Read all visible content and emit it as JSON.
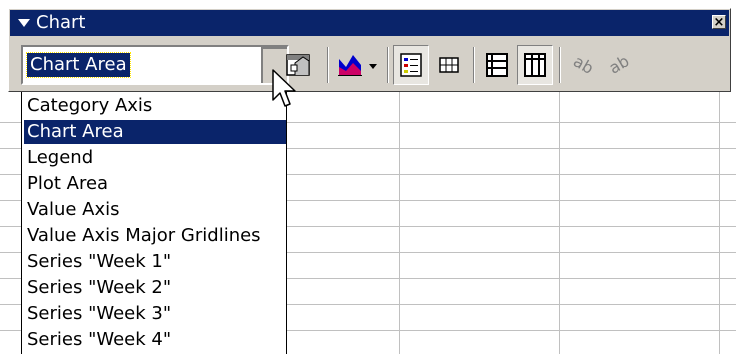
{
  "toolbar": {
    "title": "Chart",
    "close_symbol": "×",
    "chart_objects": {
      "selected": "Chart Area",
      "options": [
        "Category Axis",
        "Chart Area",
        "Legend",
        "Plot Area",
        "Value Axis",
        "Value Axis Major Gridlines",
        "Series \"Week 1\"",
        "Series \"Week 2\"",
        "Series \"Week 3\"",
        "Series \"Week 4\""
      ],
      "highlighted_index": 1
    },
    "buttons": [
      {
        "name": "format-chart-area-button",
        "icon": "format-icon"
      },
      {
        "name": "chart-type-button",
        "icon": "chart-type-icon"
      },
      {
        "name": "legend-button",
        "icon": "legend-icon"
      },
      {
        "name": "data-table-button",
        "icon": "data-table-icon"
      },
      {
        "name": "by-row-button",
        "icon": "by-row-icon"
      },
      {
        "name": "by-column-button",
        "icon": "by-column-icon"
      },
      {
        "name": "angle-text-downward-button",
        "icon": "angle-down-icon"
      },
      {
        "name": "angle-text-upward-button",
        "icon": "angle-up-icon"
      }
    ]
  },
  "colors": {
    "titlebar": "#0a246a",
    "face": "#d4d0c8",
    "selection": "#0a246a"
  }
}
